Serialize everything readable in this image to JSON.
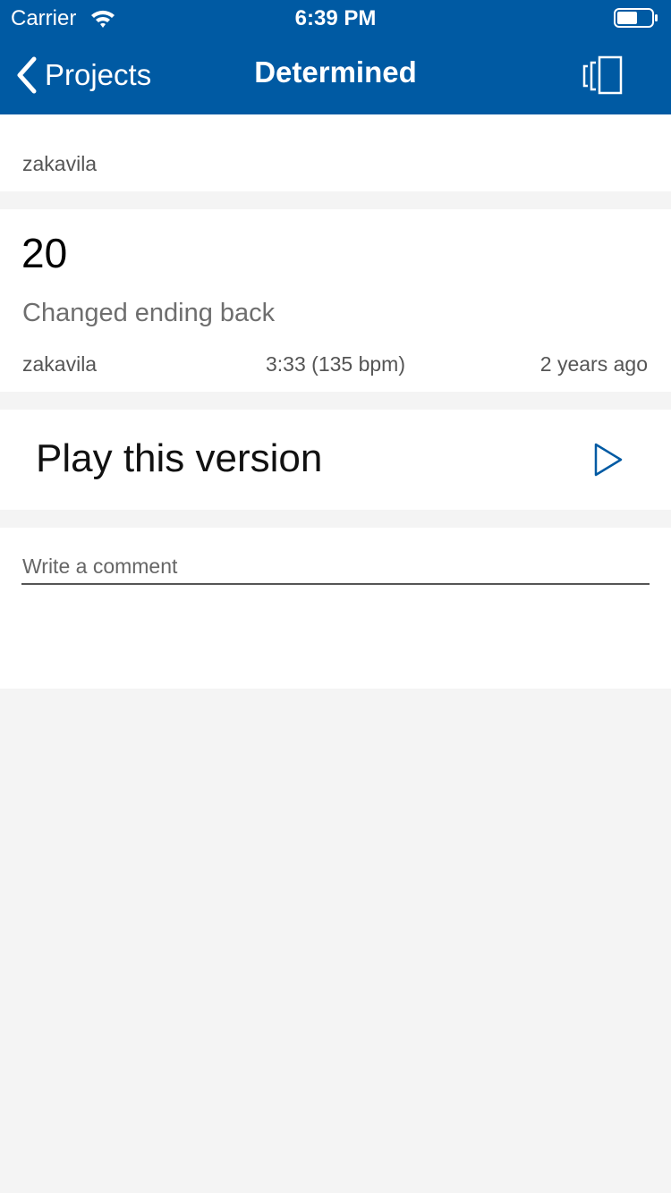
{
  "status_bar": {
    "carrier": "Carrier",
    "time": "6:39 PM"
  },
  "nav": {
    "back_label": "Projects",
    "title": "Determined",
    "right_icon": "versions-icon"
  },
  "owner": {
    "username": "zakavila"
  },
  "version": {
    "number": "20",
    "message": "Changed ending back",
    "author": "zakavila",
    "duration": "3:33 (135 bpm)",
    "age": "2 years ago"
  },
  "play": {
    "label": "Play this version",
    "icon": "play-icon"
  },
  "comment": {
    "placeholder": "Write a comment"
  },
  "colors": {
    "brand": "#005aa3",
    "background": "#f4f4f4",
    "card": "#ffffff"
  }
}
